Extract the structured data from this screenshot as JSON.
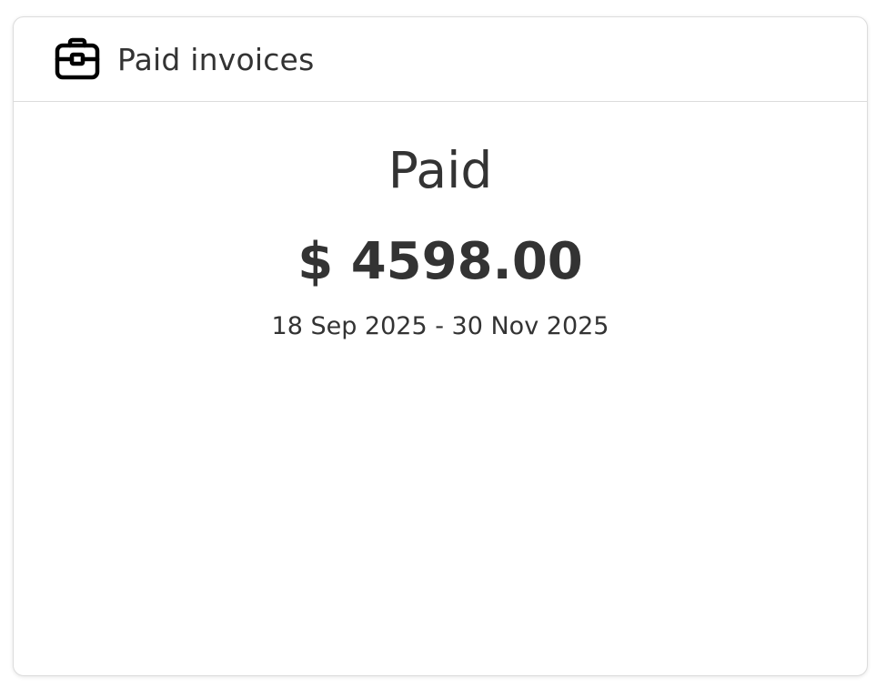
{
  "header": {
    "icon": "briefcase-icon",
    "title": "Paid invoices"
  },
  "summary": {
    "status_label": "Paid",
    "amount": "$ 4598.00",
    "date_range": "18 Sep 2025 - 30 Nov 2025"
  }
}
